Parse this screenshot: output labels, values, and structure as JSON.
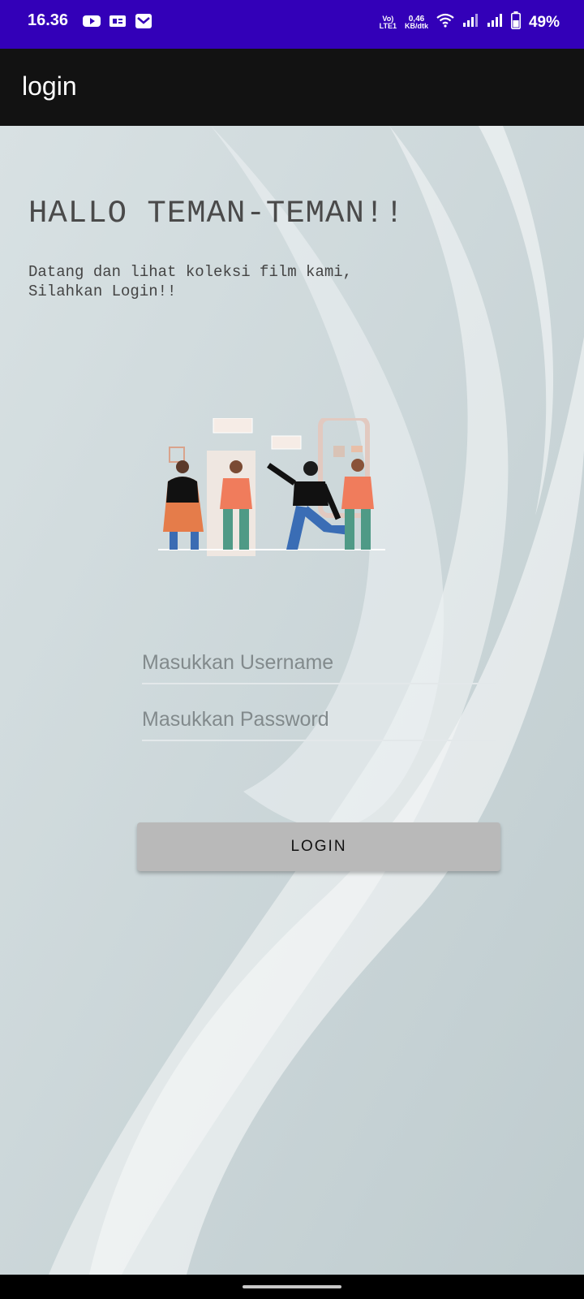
{
  "status_bar": {
    "time": "16.36",
    "network_volte": "Vo)",
    "network_lte": "LTE1",
    "speed_value": "0,46",
    "speed_unit": "KB/dtk",
    "battery_percent": "49%",
    "icons": [
      "youtube-icon",
      "ge-icon",
      "mail-icon",
      "wifi-icon",
      "signal-icon",
      "signal-icon",
      "battery-icon"
    ]
  },
  "app_bar": {
    "title": "login"
  },
  "main": {
    "headline": "HALLO TEMAN-TEMAN!!",
    "subtext_line1": "Datang dan lihat koleksi film kami,",
    "subtext_line2": "Silahkan Login!!"
  },
  "form": {
    "username_placeholder": "Masukkan Username",
    "username_value": "",
    "password_placeholder": "Masukkan Password",
    "password_value": "",
    "login_label": "LOGIN"
  },
  "colors": {
    "status_bar": "#3300b8",
    "app_bar": "#121212",
    "background": "#c2cfd1",
    "button": "#b9b9b9"
  }
}
